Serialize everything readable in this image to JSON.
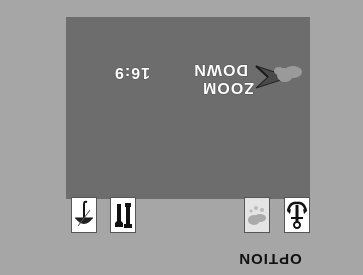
{
  "display": {
    "aspect_ratio": "16:9",
    "zoom_label": "ZOOM",
    "zoom_direction": "DOWN"
  },
  "buttons": {
    "option_label": "OPTION"
  },
  "icons": [
    "anchor-icon",
    "weather-icon",
    "tools-icon",
    "parasol-icon",
    "zoom-arrow-icon",
    "cloud-icon"
  ],
  "colors": {
    "background": "#a6a6a6",
    "lcd": "#6d6d6d",
    "text": "#ffffff"
  }
}
